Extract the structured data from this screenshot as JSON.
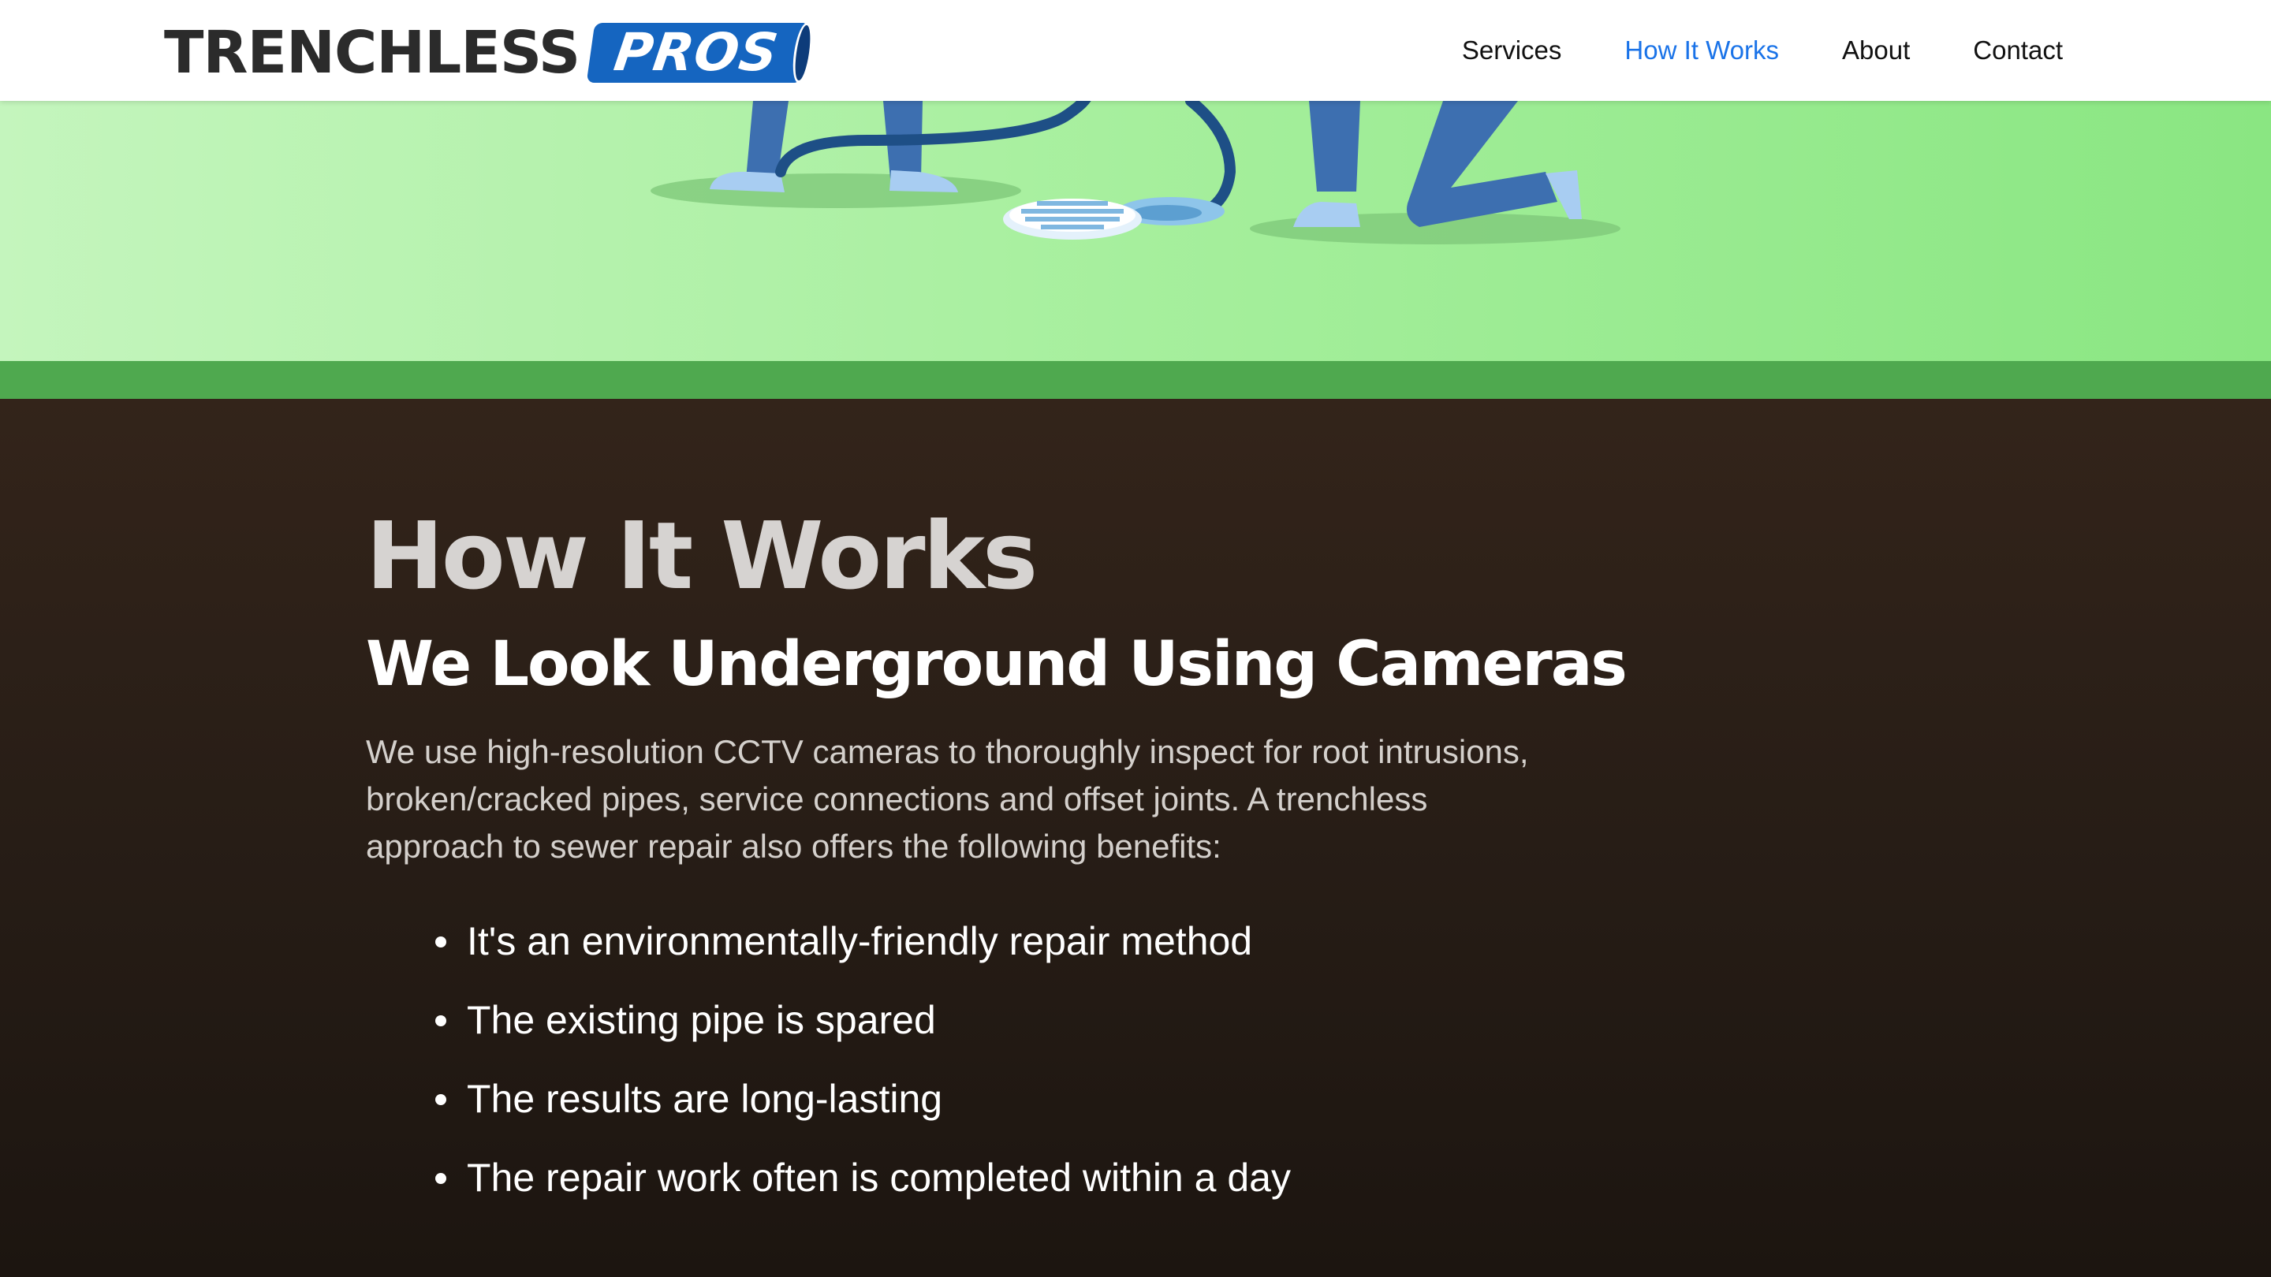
{
  "header": {
    "logo_text": "TRENCHLESS",
    "logo_badge": "PROS",
    "nav": [
      {
        "label": "Services",
        "active": false
      },
      {
        "label": "How It Works",
        "active": true
      },
      {
        "label": "About",
        "active": false
      },
      {
        "label": "Contact",
        "active": false
      }
    ]
  },
  "hero": {
    "illustration": "workers-with-pipe-camera-at-drain"
  },
  "main": {
    "title": "How It Works",
    "subtitle": "We Look Underground Using Cameras",
    "intro": "We use high-resolution CCTV cameras to thoroughly inspect for root intrusions, broken/cracked pipes, service connections and offset joints. A trenchless approach to sewer repair also offers the following benefits:",
    "benefits": [
      "It's an environmentally-friendly repair method",
      "The existing pipe is spared",
      "The results are long-lasting",
      "The repair work often is completed within a day"
    ]
  },
  "colors": {
    "nav_active": "#1a73e8",
    "logo_badge": "#1565c0",
    "green_strip": "#4fa94f",
    "content_bg": "#271d16"
  }
}
